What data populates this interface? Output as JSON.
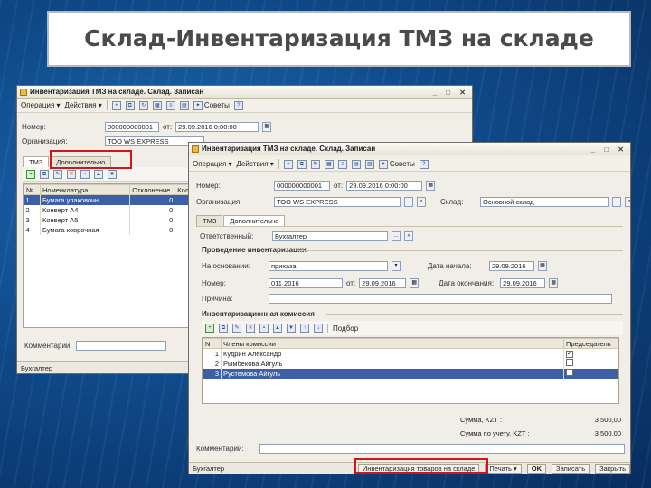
{
  "slide": {
    "title": "Склад-Инвентаризация ТМЗ на складе"
  },
  "back_window": {
    "title": "Инвентаризация ТМЗ на складе. Склад. Записан",
    "toolbar": {
      "operation": "Операция ▾",
      "actions": "Действия ▾",
      "advice": "Советы"
    },
    "number_label": "Номер:",
    "number_value": "000000000001",
    "from_label": "от:",
    "date_value": "29.09.2016 0:00:00",
    "org_label": "Организация:",
    "org_value": "ТОО WS EXPRESS",
    "tabs": [
      "ТМЗ",
      "Дополнительно"
    ],
    "table": {
      "headers": [
        "№",
        "Номенклатура",
        "Отклонение",
        "Кол"
      ],
      "rows": [
        {
          "n": "1",
          "name": "Бумага упаковочн...",
          "dev": "0"
        },
        {
          "n": "2",
          "name": "Конверт А4",
          "dev": "0"
        },
        {
          "n": "3",
          "name": "Конверт А5",
          "dev": "0"
        },
        {
          "n": "4",
          "name": "Бумага коврочная",
          "dev": "0"
        }
      ]
    },
    "comment_label": "Комментарий:",
    "status": "Бухгалтер"
  },
  "front_window": {
    "title": "Инвентаризация ТМЗ на складе. Склад. Записан",
    "toolbar": {
      "operation": "Операция ▾",
      "actions": "Действия ▾",
      "advice": "Советы"
    },
    "number_label": "Номер:",
    "number_value": "000000000001",
    "from_label": "от:",
    "date_value": "29.09.2016 0:00:00",
    "org_label": "Организация:",
    "org_value": "ТОО WS EXPRESS",
    "warehouse_label": "Склад:",
    "warehouse_value": "Основной склад",
    "tabs": [
      "ТМЗ",
      "Дополнительно"
    ],
    "responsible_label": "Ответственный:",
    "responsible_value": "Бухгалтер",
    "section_conduct": "Проведение инвентаризации",
    "basis_label": "На основании:",
    "basis_value": "приказа",
    "start_label": "Дата начала:",
    "start_value": "29.09.2016",
    "number2_label": "Номер:",
    "number2_value": "011 2016",
    "from2_label": "от:",
    "from2_value": "29.09.2016",
    "end_label": "Дата окончания:",
    "end_value": "29.09.2016",
    "reason_label": "Причина:",
    "reason_value": "",
    "section_commission": "Инвентаризационная комиссия",
    "select_label": "Подбор",
    "table": {
      "headers": [
        "N",
        "Члены комиссии",
        "Председатель"
      ],
      "rows": [
        {
          "n": "1",
          "name": "Кудрин Александр",
          "chair": "✓"
        },
        {
          "n": "2",
          "name": "Рымбекова Айгуль",
          "chair": ""
        },
        {
          "n": "3",
          "name": "Рустемова Айгуль",
          "chair": ""
        }
      ]
    },
    "total_label": "Сумма, KZT :",
    "total_value": "3 500,00",
    "total_acc_label": "Сумма по учету, KZT :",
    "total_acc_value": "3 500,00",
    "comment_label": "Комментарий:",
    "status": {
      "user": "Бухгалтер",
      "print_form": "Инвентаризация товаров на складе",
      "print": "Печать ▾",
      "ok": "OK",
      "save": "Записать",
      "close": "Закрыть"
    }
  },
  "colors": {
    "highlight_box": "#d3141b",
    "selection": "#3d5fa6"
  }
}
